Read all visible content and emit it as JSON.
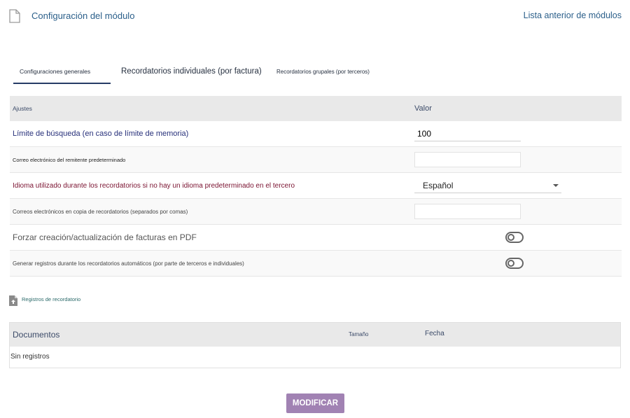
{
  "header": {
    "title": "Configuración del módulo",
    "back_link": "Lista anterior de módulos"
  },
  "tabs": [
    {
      "label": "Configuraciones generales",
      "active": true
    },
    {
      "label": "Recordatorios individuales (por factura)",
      "active": false
    },
    {
      "label": "Recordatorios grupales (por terceros)",
      "active": false
    }
  ],
  "settings": {
    "col_setting": "Ajustes",
    "col_value": "Valor",
    "rows": [
      {
        "label": "Límite de búsqueda (en caso de límite de memoria)",
        "value": "100"
      },
      {
        "label": "Correo electrónico del remitente predeterminado",
        "value": ""
      },
      {
        "label": "Idioma utilizado durante los recordatorios si no hay un idioma predeterminado en el tercero",
        "value": "Español"
      },
      {
        "label": "Correos electrónicos en copia de recordatorios (separados por comas)",
        "value": ""
      },
      {
        "label": "Forzar creación/actualización de facturas en PDF",
        "enabled": false
      },
      {
        "label": "Generar registros durante los recordatorios automáticos (por parte de terceros e individuales)",
        "enabled": false
      }
    ]
  },
  "logs": {
    "link": "Registros de recordatorio"
  },
  "documents": {
    "col_documents": "Documentos",
    "col_size": "Tamaño",
    "col_date": "Fecha",
    "empty": "Sin registros"
  },
  "actions": {
    "modify": "MODIFICAR"
  },
  "colors": {
    "link": "#2b5f8a",
    "tab_underline": "#263c66",
    "button": "#a182b3",
    "header_bg": "#e9e9e9"
  }
}
